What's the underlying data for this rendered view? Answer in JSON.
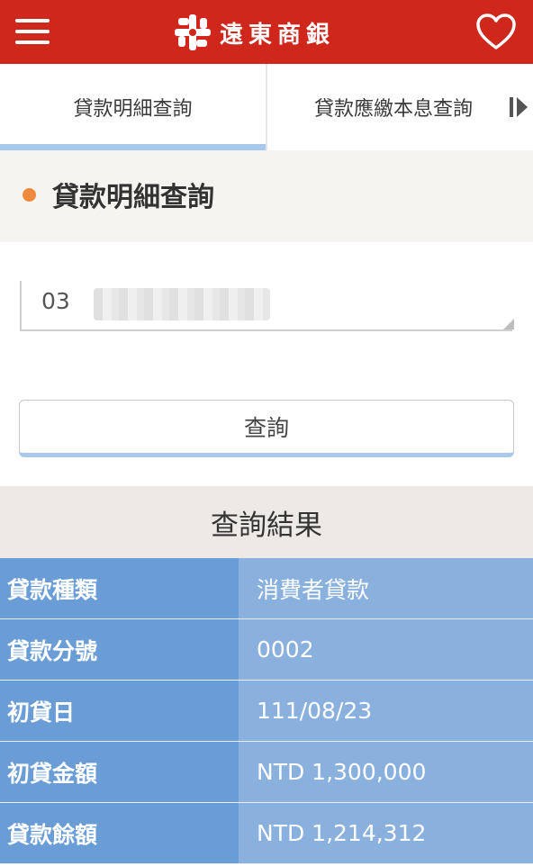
{
  "header": {
    "bank_name": "遠東商銀",
    "menu_icon": "menu-icon",
    "favorite_icon": "heart-icon",
    "brand_color": "#d0271d"
  },
  "tabs": [
    {
      "label": "貸款明細查詢",
      "active": true
    },
    {
      "label": "貸款應繳本息查詢",
      "active": false
    }
  ],
  "section": {
    "title": "貸款明細查詢",
    "dot_color": "#ef8a3c"
  },
  "account": {
    "visible_prefix": "03"
  },
  "query_button": {
    "label": "查詢"
  },
  "results": {
    "title": "查詢結果",
    "rows": [
      {
        "label": "貸款種類",
        "value": "消費者貸款"
      },
      {
        "label": "貸款分號",
        "value": "0002"
      },
      {
        "label": "初貸日",
        "value": "111/08/23"
      },
      {
        "label": "初貸金額",
        "value": "NTD 1,300,000"
      },
      {
        "label": "貸款餘額",
        "value": "NTD 1,214,312"
      }
    ]
  }
}
